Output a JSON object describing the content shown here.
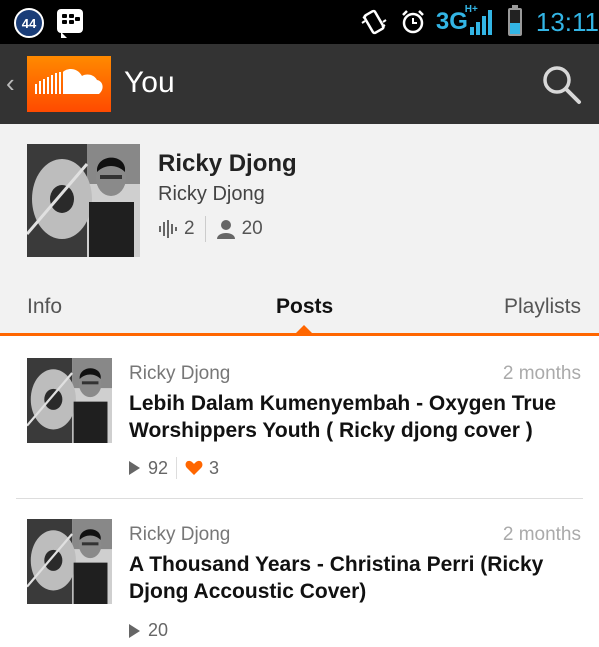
{
  "statusbar": {
    "notification_count": "44",
    "network": "3G",
    "network_sup": "H+",
    "battery_level_pct": 45,
    "time": "13:11",
    "icons": [
      "bbm-icon",
      "vibrate-icon",
      "alarm-icon",
      "signal-icon",
      "battery-icon"
    ]
  },
  "actionbar": {
    "title": "You",
    "icons": [
      "back-chevron-icon",
      "soundcloud-logo",
      "search-icon"
    ]
  },
  "profile": {
    "display_name": "Ricky Djong",
    "username": "Ricky Djong",
    "tracks_count": "2",
    "followers_count": "20",
    "icons": [
      "waveform-icon",
      "person-icon"
    ]
  },
  "tabs": {
    "items": [
      {
        "label": "Info"
      },
      {
        "label": "Posts"
      },
      {
        "label": "Playlists"
      }
    ],
    "selected": "Posts"
  },
  "posts": [
    {
      "user": "Ricky Djong",
      "time": "2 months",
      "title": "Lebih Dalam Kumenyembah - Oxygen True Worshippers Youth ( Ricky djong cover )",
      "plays": "92",
      "likes": "3"
    },
    {
      "user": "Ricky Djong",
      "time": "2 months",
      "title": "A Thousand Years - Christina Perri (Ricky Djong Accoustic Cover)",
      "plays": "20"
    }
  ],
  "colors": {
    "accent": "#ff6600",
    "status_blue": "#33b5e5",
    "actionbar": "#333333"
  }
}
